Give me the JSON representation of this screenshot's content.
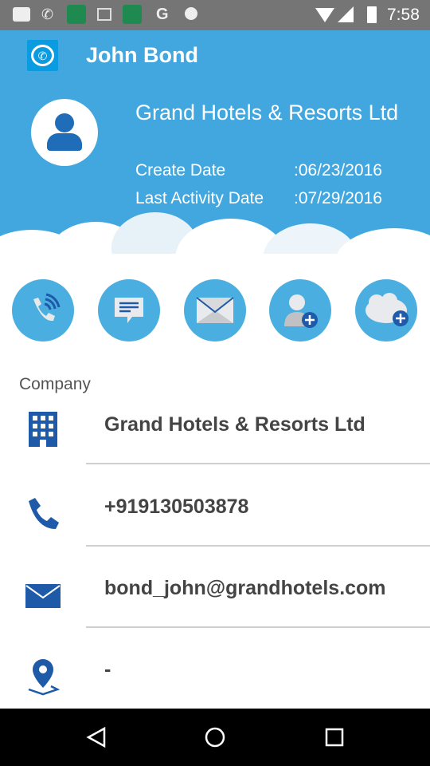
{
  "status_bar": {
    "time": "7:58"
  },
  "header": {
    "title": "John Bond"
  },
  "profile": {
    "company_name": "Grand Hotels & Resorts Ltd",
    "create_date_label": "Create Date",
    "create_date_value": ":06/23/2016",
    "last_activity_label": "Last Activity Date",
    "last_activity_value": ":07/29/2016"
  },
  "actions": [
    "call",
    "message",
    "email",
    "add-contact",
    "add-to-salesforce"
  ],
  "details": {
    "section_label": "Company",
    "company": "Grand Hotels & Resorts Ltd",
    "phone": "+919130503878",
    "email": "bond_john@grandhotels.com",
    "address": "-"
  },
  "colors": {
    "primary": "#42a7df",
    "icon": "#1e5aa8"
  }
}
